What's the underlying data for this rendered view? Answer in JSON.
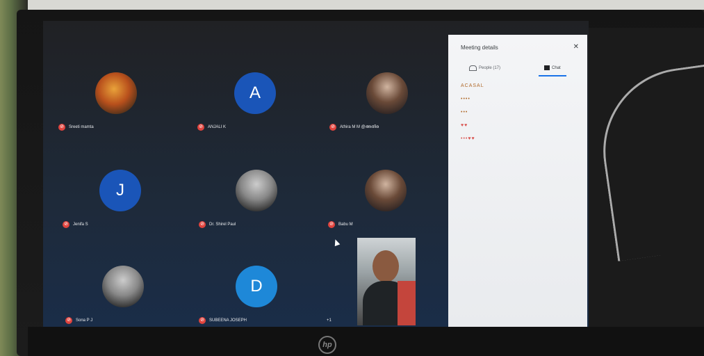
{
  "screen": {
    "participants": [
      {
        "name": "Sreeti mamta",
        "initial": "",
        "kind": "photo-warm"
      },
      {
        "name": "ANJALI K",
        "initial": "A",
        "kind": "letter",
        "color": "#1a55b8"
      },
      {
        "name": "Athira M M @അതിര",
        "initial": "",
        "kind": "photo-dark"
      },
      {
        "name": "Jenifa S",
        "initial": "J",
        "kind": "letter",
        "color": "#1a55b8"
      },
      {
        "name": "Dr. Shirel Paul",
        "initial": "",
        "kind": "photo"
      },
      {
        "name": "Babu M",
        "initial": "",
        "kind": "photo-dark"
      },
      {
        "name": "Sona P J",
        "initial": "",
        "kind": "photo"
      },
      {
        "name": "SUBEENA JOSEPH",
        "initial": "D",
        "kind": "letter",
        "color": "#1e88d8"
      }
    ],
    "more_badge": "+1",
    "panel": {
      "title": "Meeting details",
      "close_icon": "close-icon",
      "tab_people": "People (17)",
      "tab_chat": "Chat",
      "messages": [
        {
          "meta": "",
          "text": "",
          "emoji": "ACASAL"
        },
        {
          "meta": "",
          "text": "",
          "emoji": "••••"
        },
        {
          "meta": "",
          "text": "",
          "emoji": ""
        },
        {
          "meta": "",
          "text": "",
          "emoji": "•••"
        },
        {
          "meta": "",
          "text": "",
          "emoji": ""
        },
        {
          "meta": "",
          "text": "",
          "emoji": "♥♥"
        },
        {
          "meta": "",
          "text": "",
          "emoji": "•••♥♥"
        },
        {
          "meta": "",
          "text": "",
          "emoji": ""
        }
      ]
    }
  },
  "device": {
    "logo": "hp"
  }
}
